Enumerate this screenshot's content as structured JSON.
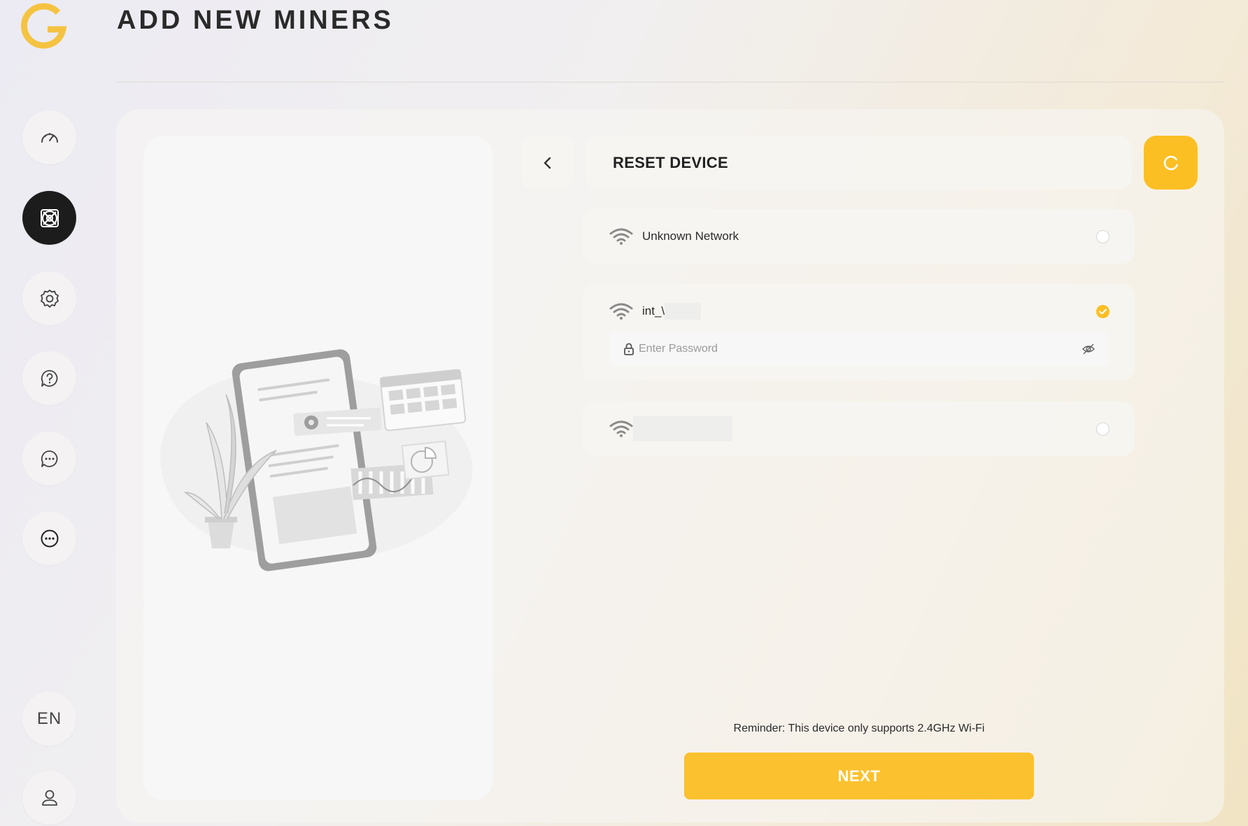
{
  "header": {
    "title": "ADD NEW MINERS"
  },
  "sidebar": {
    "items": [
      {
        "name": "dashboard",
        "icon": "speedometer-icon",
        "active": false
      },
      {
        "name": "miners",
        "icon": "miner-chip-icon",
        "active": true
      },
      {
        "name": "settings",
        "icon": "gear-icon",
        "active": false
      },
      {
        "name": "help",
        "icon": "question-bubble-icon",
        "active": false
      },
      {
        "name": "messages",
        "icon": "chat-bubble-icon",
        "active": false
      },
      {
        "name": "more",
        "icon": "more-dots-icon",
        "active": false
      }
    ],
    "language": "EN",
    "profile_icon": "user-icon"
  },
  "step": {
    "title": "RESET DEVICE",
    "back_icon": "chevron-left-icon",
    "refresh_icon": "refresh-icon"
  },
  "networks": [
    {
      "ssid": "Unknown Network",
      "selected": false
    },
    {
      "ssid": "int_\\",
      "selected": true,
      "password_placeholder": "Enter Password"
    },
    {
      "ssid": "",
      "selected": false
    }
  ],
  "footer": {
    "reminder": "Reminder: This device only supports 2.4GHz Wi-Fi",
    "next_label": "NEXT"
  },
  "colors": {
    "accent": "#fbbf24",
    "active_nav": "#1c1c1c"
  }
}
